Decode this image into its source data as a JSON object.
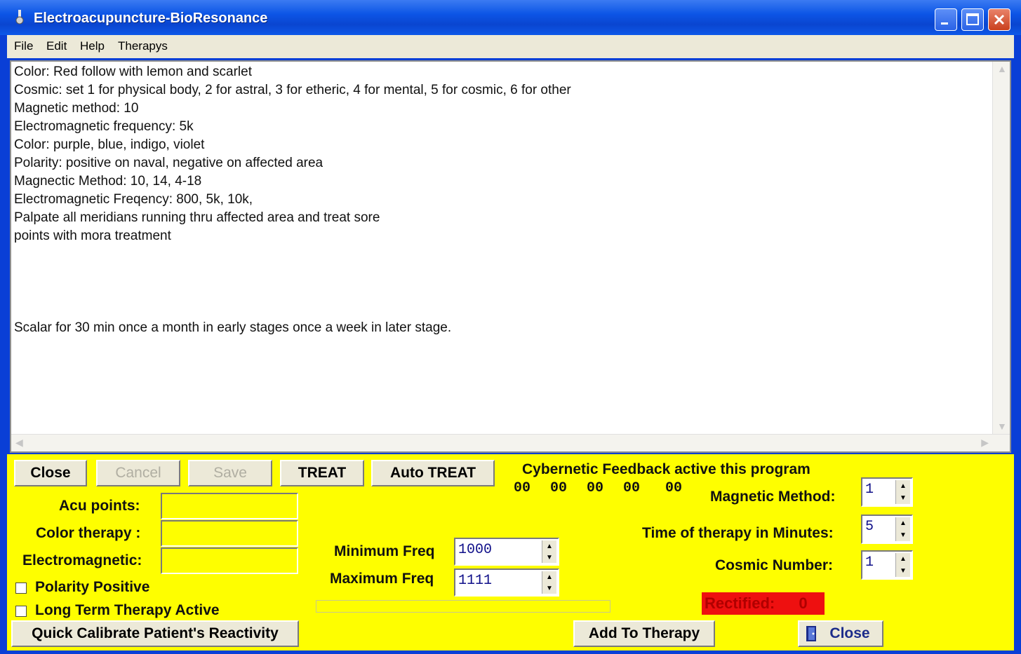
{
  "window": {
    "title": "Electroacupuncture-BioResonance"
  },
  "menu": [
    "File",
    "Edit",
    "Help",
    "Therapys"
  ],
  "text_lines": [
    "Color: Red follow with lemon and scarlet",
    "Cosmic:  set 1 for physical body, 2 for astral, 3 for etheric, 4 for mental, 5 for cosmic, 6 for other",
    "Magnetic method: 10",
    "Electromagnetic frequency: 5k",
    "Color: purple, blue, indigo, violet",
    "Polarity: positive on naval, negative on affected area",
    "Magnectic Method: 10, 14, 4-18",
    "Electromagnetic Freqency: 800, 5k, 10k,",
    "Palpate all meridians running thru affected area and treat sore",
    "points with mora treatment"
  ],
  "text_footer": "Scalar   for 30 min once a month in early stages once a week in later stage.",
  "buttons": {
    "close": "Close",
    "cancel": "Cancel",
    "save": "Save",
    "treat": "TREAT",
    "auto_treat": "Auto TREAT",
    "quick_calibrate": "Quick Calibrate Patient's Reactivity",
    "add_to_therapy": "Add To Therapy",
    "close2": "Close"
  },
  "labels": {
    "acu_points": "Acu points:",
    "color_therapy": "Color therapy :",
    "electromagnetic": "Electromagnetic:",
    "polarity_positive": "Polarity Positive",
    "long_term": "Long Term Therapy Active",
    "min_freq": "Minimum Freq",
    "max_freq": "Maximum Freq",
    "cybernetic": "Cybernetic Feedback active this program",
    "magnetic_method": "Magnetic Method:",
    "time_of_therapy": "Time of therapy in Minutes:",
    "cosmic_number": "Cosmic Number:"
  },
  "values": {
    "min_freq": "1000",
    "max_freq": "1111",
    "magnetic_method": "1",
    "time_minutes": "5",
    "cosmic_number": "1",
    "counters": [
      "00",
      "00",
      "00",
      "00",
      "00"
    ],
    "rectified_label": "Rectified:",
    "rectified_value": "0"
  },
  "checkboxes": {
    "polarity_positive": false,
    "long_term": false
  },
  "colors": {
    "panel": "#fefe00",
    "rectified_bg": "#ee1010",
    "titlebar": "#0c55e6"
  }
}
